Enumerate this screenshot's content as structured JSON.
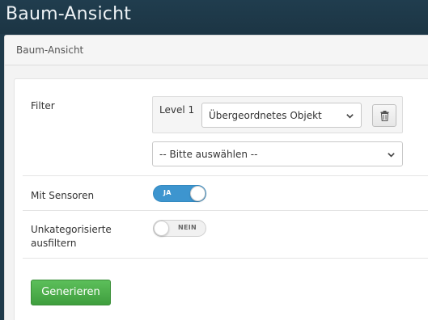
{
  "app": {
    "title": "Baum-Ansicht"
  },
  "panel": {
    "title": "Baum-Ansicht"
  },
  "form": {
    "filter": {
      "label": "Filter",
      "level_label": "Level 1",
      "level_select_value": "Übergeordnetes Objekt",
      "second_select_value": "-- Bitte auswählen --"
    },
    "sensors": {
      "label": "Mit Sensoren",
      "toggle_text": "JA",
      "state": "on"
    },
    "uncategorized": {
      "label_line1": "Unkategorisierte",
      "label_line2": "ausfiltern",
      "toggle_text": "NEIN",
      "state": "off"
    },
    "submit_label": "Generieren"
  },
  "icons": {
    "delete": "trash-icon",
    "dropdown": "chevron-down-icon"
  },
  "colors": {
    "header_bg": "#1f3a4a",
    "toggle_on": "#3d95cf",
    "button_green": "#4cae4c"
  }
}
